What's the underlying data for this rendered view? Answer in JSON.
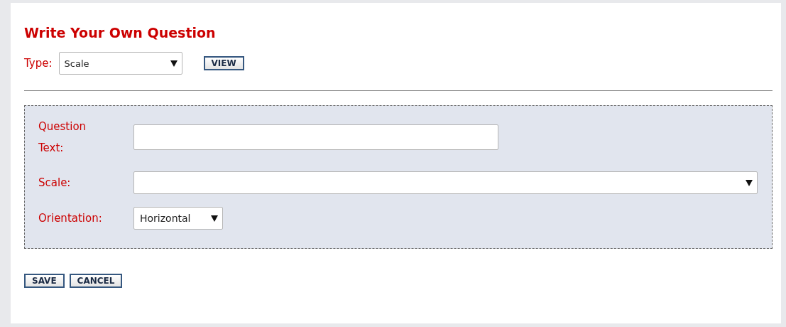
{
  "title": "Write Your Own Question",
  "type_field": {
    "label": "Type:",
    "value": "Scale"
  },
  "view_button": "VIEW",
  "fields": [
    {
      "kind": "text",
      "label": "Question Text:"
    },
    {
      "kind": "select",
      "label": "Scale:"
    },
    {
      "kind": "select",
      "label": "Orientation:",
      "value": "Horizontal"
    }
  ],
  "buttons": [
    "SAVE",
    "CANCEL"
  ]
}
